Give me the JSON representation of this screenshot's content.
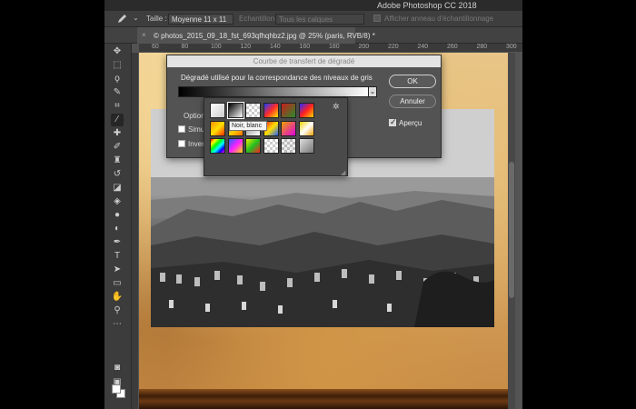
{
  "app": {
    "title": "Adobe Photoshop CC 2018"
  },
  "options_bar": {
    "size_label": "Taille :",
    "size_value": "Moyenne 11 x 11",
    "sample_label": "Echantillon :",
    "sample_value": "Tous les calques",
    "ring_label": "Afficher anneau d'échantillonnage"
  },
  "document_tab": {
    "close": "×",
    "title": "© photos_2015_09_18_fst_693qfhqhbz2.jpg @ 25% (paris, RVB/8) *"
  },
  "ruler": {
    "ticks": [
      "60",
      "80",
      "100",
      "120",
      "140",
      "160",
      "180",
      "200",
      "220",
      "240",
      "260",
      "280",
      "300"
    ]
  },
  "dialog": {
    "title": "Courbe de transfert de dégradé",
    "gradient_label": "Dégradé utilisé pour la correspondance des niveaux de gris",
    "options_label": "Option",
    "simulate_label": "Simu",
    "invert_label": "Inver",
    "ok": "OK",
    "cancel": "Annuler",
    "preview": "Aperçu",
    "preview_checked": true
  },
  "gradient_picker": {
    "tooltip": "Noir, blanc",
    "selected_index": 1
  },
  "colors": {
    "accent": "#535353",
    "dialog_bg": "#535353",
    "parchment": "#d9a862"
  }
}
